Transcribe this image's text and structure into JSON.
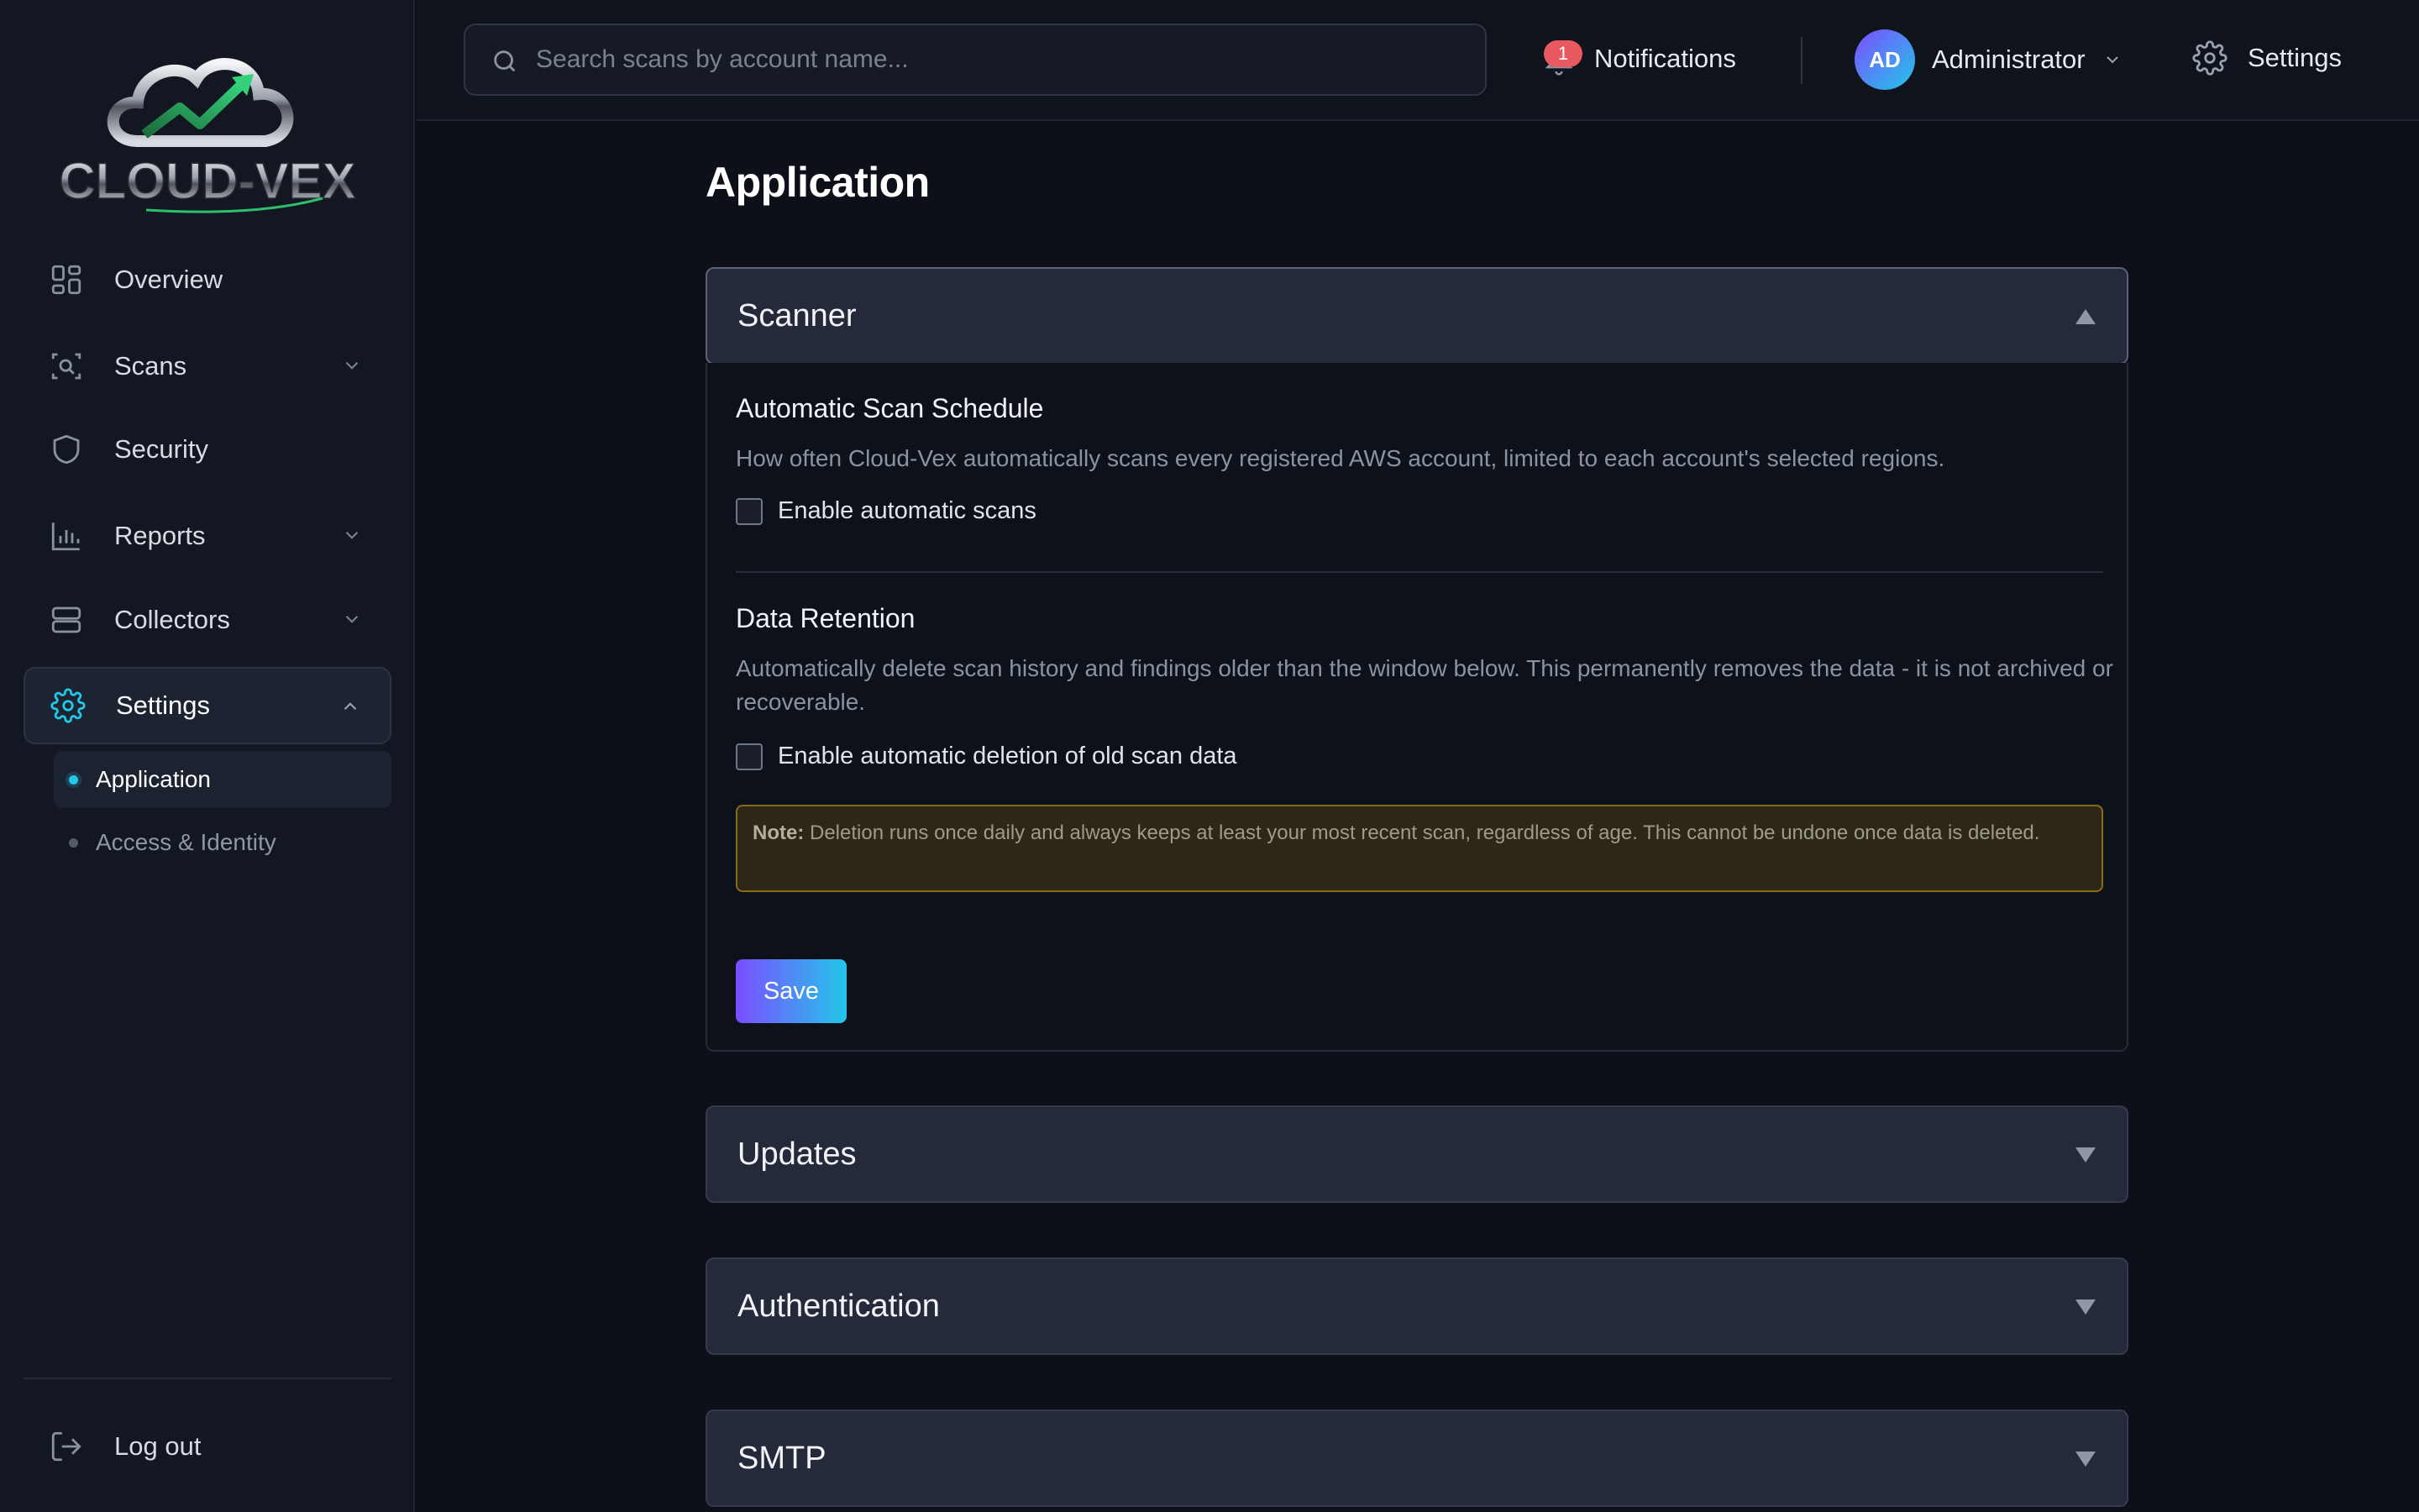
{
  "brand": {
    "name": "CLOUD-VEX"
  },
  "sidebar": {
    "items": [
      {
        "label": "Overview",
        "icon": "grid-icon"
      },
      {
        "label": "Scans",
        "icon": "scan-icon"
      },
      {
        "label": "Security",
        "icon": "shield-icon"
      },
      {
        "label": "Reports",
        "icon": "bar-chart-icon"
      },
      {
        "label": "Collectors",
        "icon": "server-icon"
      },
      {
        "label": "Settings",
        "icon": "gear-icon"
      }
    ],
    "settings_sub": [
      {
        "label": "Application"
      },
      {
        "label": "Access & Identity"
      }
    ],
    "logout": "Log out"
  },
  "topbar": {
    "search_placeholder": "Search scans by account name...",
    "notifications_label": "Notifications",
    "notifications_count": "1",
    "user_initials": "AD",
    "user_name": "Administrator",
    "settings_label": "Settings"
  },
  "main": {
    "title": "Application",
    "panels": [
      {
        "title": "Scanner",
        "expanded": true
      },
      {
        "title": "Updates",
        "expanded": false
      },
      {
        "title": "Authentication",
        "expanded": false
      },
      {
        "title": "SMTP",
        "expanded": false
      }
    ],
    "scanner": {
      "schedule_title": "Automatic Scan Schedule",
      "schedule_desc": "How often Cloud-Vex automatically scans every registered AWS account, limited to each account's selected regions.",
      "schedule_checkbox": "Enable automatic scans",
      "retention_title": "Data Retention",
      "retention_desc": "Automatically delete scan history and findings older than the window below. This permanently removes the data - it is not archived or recoverable.",
      "retention_checkbox": "Enable automatic deletion of old scan data",
      "note_label": "Note:",
      "note_text": " Deletion runs once daily and always keeps at least your most recent scan, regardless of age. This cannot be undone once data is deleted.",
      "save_label": "Save"
    }
  },
  "colors": {
    "accent_cyan": "#22c7e8",
    "accent_purple": "#7c4dff",
    "badge_red": "#e85a5f",
    "note_border": "#8a6a1d"
  }
}
